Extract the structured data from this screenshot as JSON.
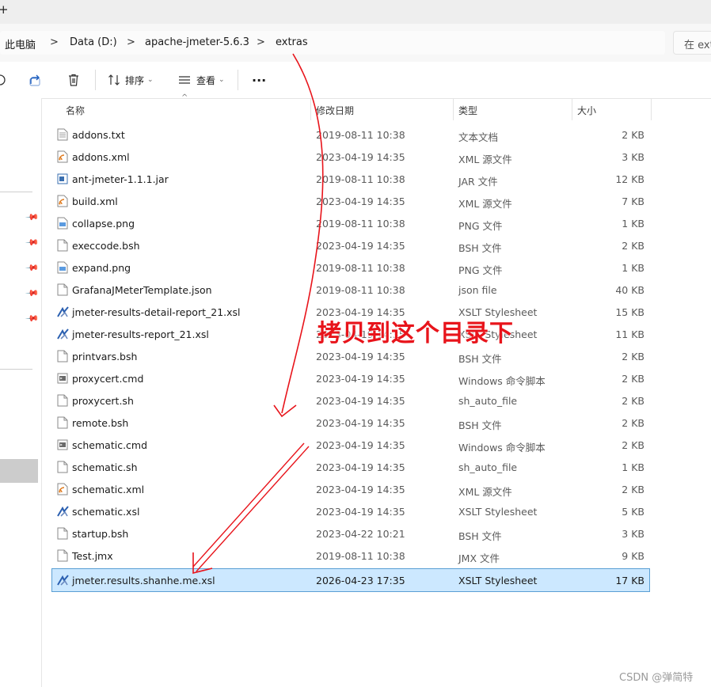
{
  "tab": {
    "new_tab": "+"
  },
  "breadcrumb": {
    "items": [
      "此电脑",
      "Data (D:)",
      "apache-jmeter-5.6.3",
      "extras"
    ],
    "separator": ">"
  },
  "search": {
    "placeholder": "在 ext"
  },
  "toolbar": {
    "sort_label": "排序",
    "view_label": "查看",
    "more_label": "..."
  },
  "columns": {
    "name": "名称",
    "date": "修改日期",
    "type": "类型",
    "size": "大小"
  },
  "files": [
    {
      "name": "addons.txt",
      "date": "2019-08-11 10:38",
      "type": "文本文档",
      "size": "2 KB",
      "icon": "text-file-icon"
    },
    {
      "name": "addons.xml",
      "date": "2023-04-19 14:35",
      "type": "XML 源文件",
      "size": "3 KB",
      "icon": "xml-file-icon"
    },
    {
      "name": "ant-jmeter-1.1.1.jar",
      "date": "2019-08-11 10:38",
      "type": "JAR 文件",
      "size": "12 KB",
      "icon": "jar-file-icon"
    },
    {
      "name": "build.xml",
      "date": "2023-04-19 14:35",
      "type": "XML 源文件",
      "size": "7 KB",
      "icon": "xml-file-icon"
    },
    {
      "name": "collapse.png",
      "date": "2019-08-11 10:38",
      "type": "PNG 文件",
      "size": "1 KB",
      "icon": "image-file-icon"
    },
    {
      "name": "execcode.bsh",
      "date": "2023-04-19 14:35",
      "type": "BSH 文件",
      "size": "2 KB",
      "icon": "blank-file-icon"
    },
    {
      "name": "expand.png",
      "date": "2019-08-11 10:38",
      "type": "PNG 文件",
      "size": "1 KB",
      "icon": "image-file-icon"
    },
    {
      "name": "GrafanaJMeterTemplate.json",
      "date": "2019-08-11 10:38",
      "type": "json file",
      "size": "40 KB",
      "icon": "blank-file-icon"
    },
    {
      "name": "jmeter-results-detail-report_21.xsl",
      "date": "2023-04-19 14:35",
      "type": "XSLT Stylesheet",
      "size": "15 KB",
      "icon": "xslt-file-icon"
    },
    {
      "name": "jmeter-results-report_21.xsl",
      "date": "2023-04-19 14:35",
      "type": "XSLT Stylesheet",
      "size": "11 KB",
      "icon": "xslt-file-icon"
    },
    {
      "name": "printvars.bsh",
      "date": "2023-04-19 14:35",
      "type": "BSH 文件",
      "size": "2 KB",
      "icon": "blank-file-icon"
    },
    {
      "name": "proxycert.cmd",
      "date": "2023-04-19 14:35",
      "type": "Windows 命令脚本",
      "size": "2 KB",
      "icon": "cmd-file-icon"
    },
    {
      "name": "proxycert.sh",
      "date": "2023-04-19 14:35",
      "type": "sh_auto_file",
      "size": "2 KB",
      "icon": "blank-file-icon"
    },
    {
      "name": "remote.bsh",
      "date": "2023-04-19 14:35",
      "type": "BSH 文件",
      "size": "2 KB",
      "icon": "blank-file-icon"
    },
    {
      "name": "schematic.cmd",
      "date": "2023-04-19 14:35",
      "type": "Windows 命令脚本",
      "size": "2 KB",
      "icon": "cmd-file-icon"
    },
    {
      "name": "schematic.sh",
      "date": "2023-04-19 14:35",
      "type": "sh_auto_file",
      "size": "1 KB",
      "icon": "blank-file-icon"
    },
    {
      "name": "schematic.xml",
      "date": "2023-04-19 14:35",
      "type": "XML 源文件",
      "size": "2 KB",
      "icon": "xml-file-icon"
    },
    {
      "name": "schematic.xsl",
      "date": "2023-04-19 14:35",
      "type": "XSLT Stylesheet",
      "size": "5 KB",
      "icon": "xslt-file-icon"
    },
    {
      "name": "startup.bsh",
      "date": "2023-04-22 10:21",
      "type": "BSH 文件",
      "size": "3 KB",
      "icon": "blank-file-icon"
    },
    {
      "name": "Test.jmx",
      "date": "2019-08-11 10:38",
      "type": "JMX 文件",
      "size": "9 KB",
      "icon": "blank-file-icon"
    },
    {
      "name": "jmeter.results.shanhe.me.xsl",
      "date": "2026-04-23 17:35",
      "type": "XSLT Stylesheet",
      "size": "17 KB",
      "icon": "xslt-file-icon",
      "selected": true
    }
  ],
  "annotation": {
    "text": "拷贝到这个目录下",
    "color": "#e8141b"
  },
  "watermark": {
    "text": "CSDN @弹简特"
  },
  "colors": {
    "selection": "#cce8ff",
    "selection_border": "#5a9fd4",
    "annotation_red": "#e8141b"
  }
}
